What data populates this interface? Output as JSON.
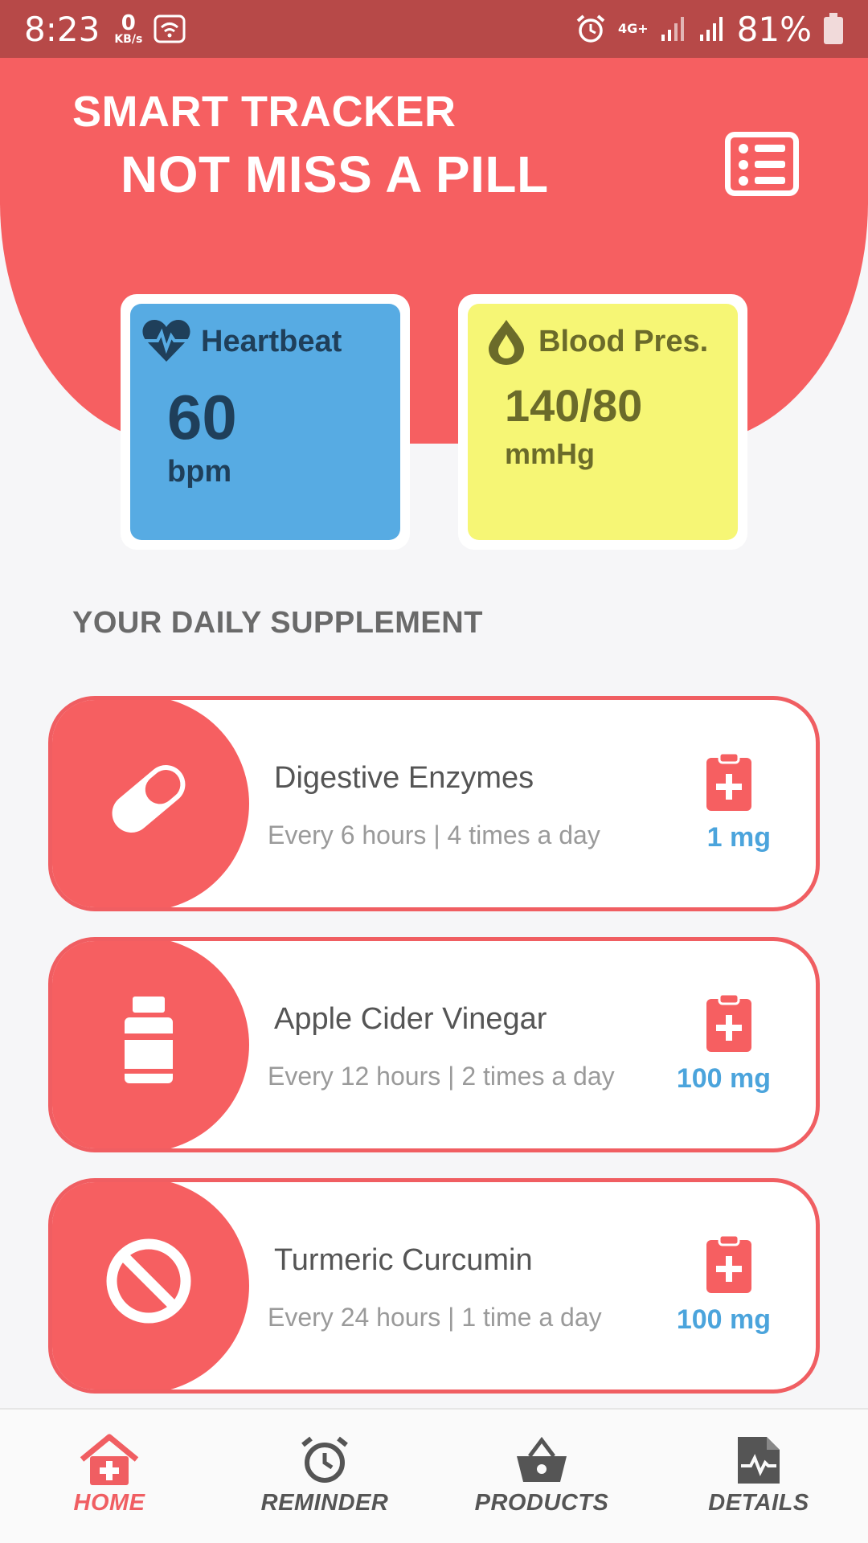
{
  "status_bar": {
    "time": "8:23",
    "speed_value": "0",
    "speed_unit": "KB/s",
    "network": "4G+",
    "battery": "81%"
  },
  "header": {
    "title_line1": "SMART TRACKER",
    "title_line2": "NOT MISS A PILL"
  },
  "vitals": {
    "heartbeat": {
      "label": "Heartbeat",
      "value": "60",
      "unit": "bpm",
      "icon": "heart-pulse-icon",
      "color": "#57abe3"
    },
    "blood_pressure": {
      "label": "Blood Pres.",
      "value": "140/80",
      "unit": "mmHg",
      "icon": "drop-icon",
      "color": "#f6f675"
    }
  },
  "section_title": "YOUR DAILY SUPPLEMENT",
  "supplements": [
    {
      "name": "Digestive Enzymes",
      "schedule": "Every 6 hours | 4 times a day",
      "dose": "1 mg",
      "icon": "capsule-icon"
    },
    {
      "name": "Apple Cider Vinegar",
      "schedule": "Every 12 hours | 2 times a day",
      "dose": "100 mg",
      "icon": "bottle-icon"
    },
    {
      "name": "Turmeric Curcumin",
      "schedule": "Every 24 hours | 1 time a day",
      "dose": "100 mg",
      "icon": "prohibited-icon"
    }
  ],
  "nav": {
    "home": "HOME",
    "reminder": "REMINDER",
    "products": "PRODUCTS",
    "details": "DETAILS",
    "active": "home"
  },
  "colors": {
    "accent": "#f65f61",
    "status_bar": "#b74948",
    "dose": "#4ba4dc"
  }
}
